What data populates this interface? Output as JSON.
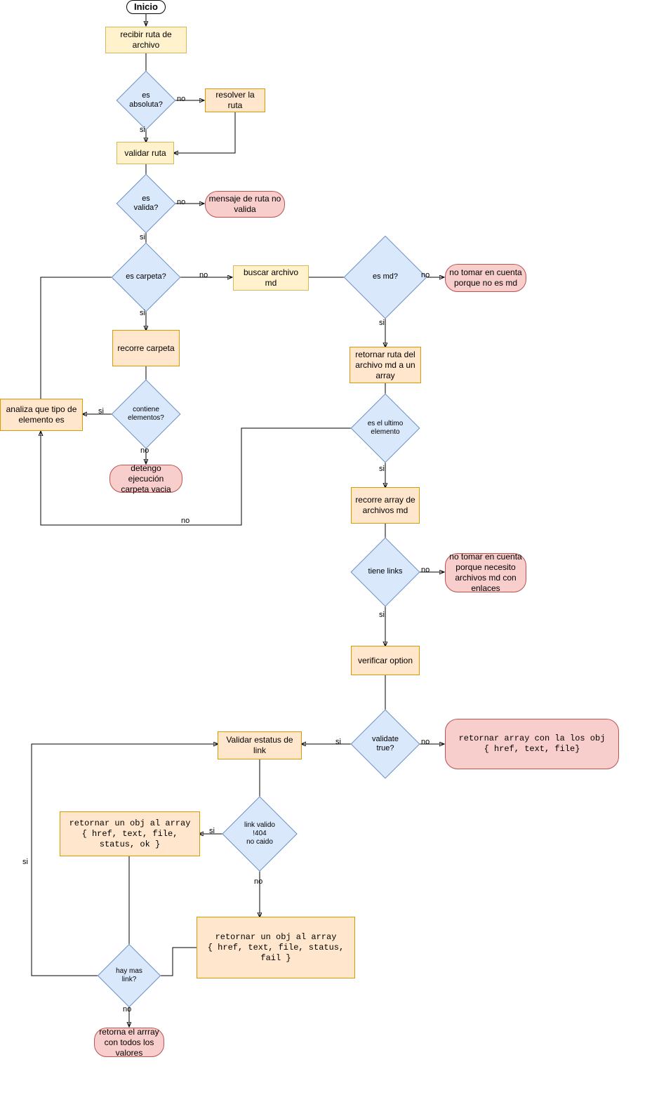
{
  "nodes": {
    "inicio": "Inicio",
    "recibir_ruta": "recibir ruta de archivo",
    "es_absoluta": "es absoluta?",
    "resolver_ruta": "resolver la ruta",
    "validar_ruta": "validar ruta",
    "es_valida": "es valida?",
    "mensaje_ruta_no_valida": "mensaje de ruta no valida",
    "es_carpeta": "es carpeta?",
    "buscar_archivo_md": "buscar archivo md",
    "es_md": "es md?",
    "no_tomar_no_md": "no tomar en cuenta porque no es md",
    "recorre_carpeta": "recorre carpeta",
    "contiene_elementos": "contiene elementos?",
    "analiza_tipo": "analiza que tipo de elemento es",
    "detengo_vacia": "detengo ejecución carpeta vacia",
    "retornar_ruta_array": "retornar ruta del archivo md a un array",
    "es_ultimo_elemento": "es el ultimo elemento",
    "recorre_array_md": "recorre array de archivos md",
    "tiene_links": "tiene links",
    "no_tomar_no_links": "no tomar en cuenta porque necesito archivos md con enlaces",
    "verificar_option": "verificar option",
    "validate_true": "validate true?",
    "retornar_array_obj": "retornar  array con la los obj\n{ href, text, file}",
    "validar_estatus": "Validar estatus de link",
    "link_valido": "link valido\n!404\nno caido",
    "retornar_obj_ok": "retornar un obj al array\n{ href, text, file, status, ok }",
    "retornar_obj_fail": "retornar un obj al array\n{ href, text, file, status, fail }",
    "hay_mas_link": "hay mas link?",
    "retorna_array_todos": "retorna el arrray con todos los valores"
  },
  "labels": {
    "si": "si",
    "no": "no"
  }
}
